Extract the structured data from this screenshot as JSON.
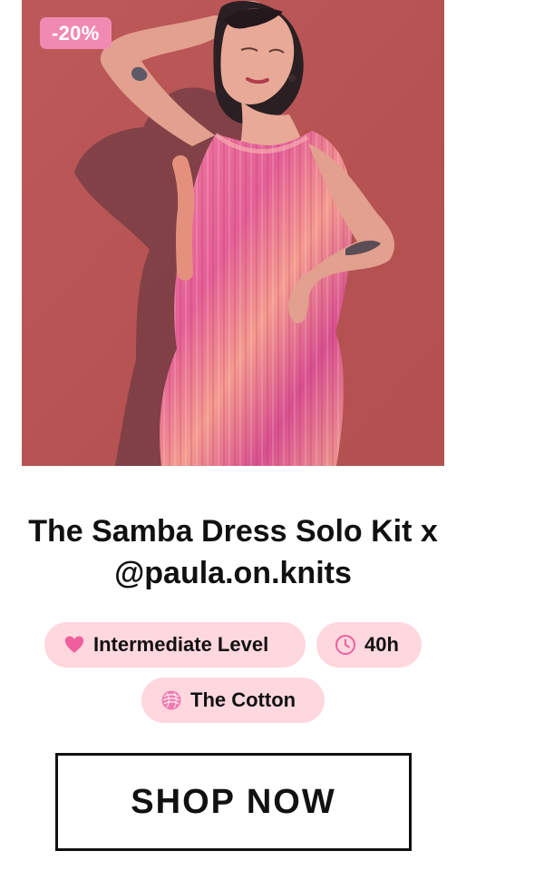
{
  "product": {
    "discount_badge": "-20%",
    "title": "The Samba Dress Solo Kit x @paula.on.knits",
    "image_description_icon": "knitted-dress-model"
  },
  "chips": {
    "level": {
      "label": "Intermediate Level",
      "icon": "heart-icon"
    },
    "time": {
      "label": "40h",
      "icon": "clock-icon"
    },
    "yarn": {
      "label": "The Cotton",
      "icon": "yarn-ball-icon"
    }
  },
  "cta": {
    "label": "SHOP NOW"
  },
  "colors": {
    "badge_background": "#f18ab3",
    "chip_background": "#ffd7df",
    "chip_icon": "#ef5f9d",
    "photo_background": "#b85454"
  }
}
